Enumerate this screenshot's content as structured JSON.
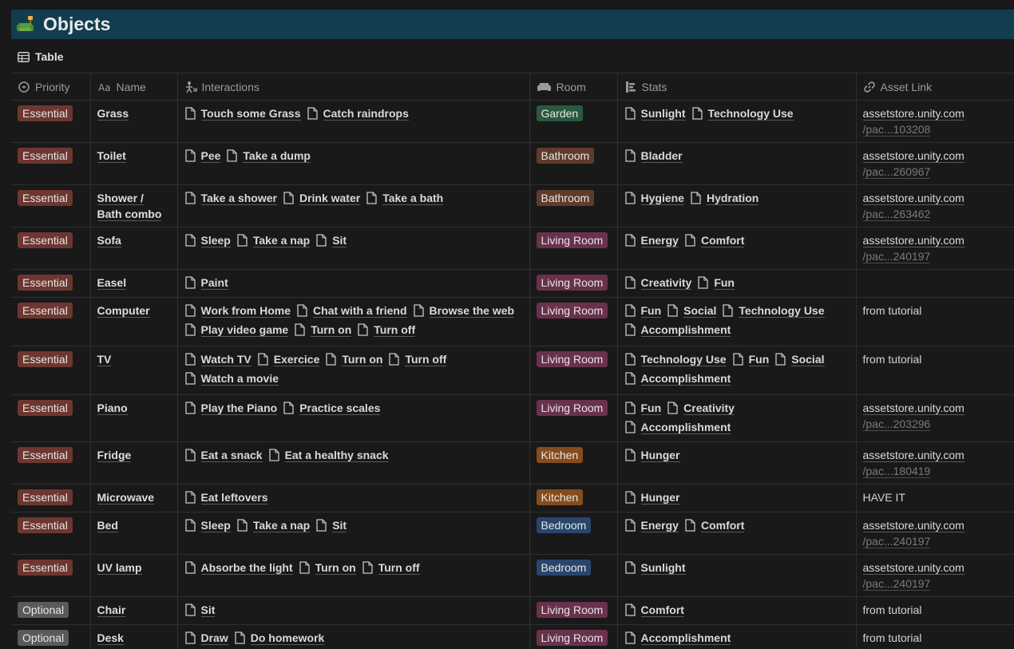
{
  "page": {
    "title": "Objects",
    "view_label": "Table"
  },
  "columns": [
    "Priority",
    "Name",
    "Interactions",
    "Room",
    "Stats",
    "Asset Link"
  ],
  "rows": [
    {
      "priority": "Essential",
      "name": "Grass",
      "interactions": [
        "Touch some Grass",
        "Catch raindrops"
      ],
      "room": "Garden",
      "room_key": "garden",
      "stats": [
        "Sunlight",
        "Technology Use"
      ],
      "asset_host": "assetstore.unity.com",
      "asset_path": "/pac...103208",
      "asset_text": ""
    },
    {
      "priority": "Essential",
      "name": "Toilet",
      "interactions": [
        "Pee",
        "Take a dump"
      ],
      "room": "Bathroom",
      "room_key": "bathroom",
      "stats": [
        "Bladder"
      ],
      "asset_host": "assetstore.unity.com",
      "asset_path": "/pac...260967",
      "asset_text": ""
    },
    {
      "priority": "Essential",
      "name": "Shower / Bath combo",
      "interactions": [
        "Take a shower",
        "Drink water",
        "Take a bath"
      ],
      "room": "Bathroom",
      "room_key": "bathroom",
      "stats": [
        "Hygiene",
        "Hydration"
      ],
      "asset_host": "assetstore.unity.com",
      "asset_path": "/pac...263462",
      "asset_text": ""
    },
    {
      "priority": "Essential",
      "name": "Sofa",
      "interactions": [
        "Sleep",
        "Take a nap",
        "Sit"
      ],
      "room": "Living Room",
      "room_key": "living",
      "stats": [
        "Energy",
        "Comfort"
      ],
      "asset_host": "assetstore.unity.com",
      "asset_path": "/pac...240197",
      "asset_text": ""
    },
    {
      "priority": "Essential",
      "name": "Easel",
      "interactions": [
        "Paint"
      ],
      "room": "Living Room",
      "room_key": "living",
      "stats": [
        "Creativity",
        "Fun"
      ],
      "asset_host": "",
      "asset_path": "",
      "asset_text": ""
    },
    {
      "priority": "Essential",
      "name": "Computer",
      "interactions": [
        "Work from Home",
        "Chat with a friend",
        "Browse the web",
        "Play video game",
        "Turn on",
        "Turn off"
      ],
      "room": "Living Room",
      "room_key": "living",
      "stats": [
        "Fun",
        "Social",
        "Technology Use",
        "Accomplishment"
      ],
      "asset_host": "",
      "asset_path": "",
      "asset_text": "from tutorial"
    },
    {
      "priority": "Essential",
      "name": "TV",
      "interactions": [
        "Watch TV",
        "Exercice",
        "Turn on",
        "Turn off",
        "Watch a movie"
      ],
      "room": "Living Room",
      "room_key": "living",
      "stats": [
        "Technology Use",
        "Fun",
        "Social",
        "Accomplishment"
      ],
      "asset_host": "",
      "asset_path": "",
      "asset_text": "from tutorial"
    },
    {
      "priority": "Essential",
      "name": "Piano",
      "interactions": [
        "Play the Piano",
        "Practice scales"
      ],
      "room": "Living Room",
      "room_key": "living",
      "stats": [
        "Fun",
        "Creativity",
        "Accomplishment"
      ],
      "asset_host": "assetstore.unity.com",
      "asset_path": "/pac...203296",
      "asset_text": ""
    },
    {
      "priority": "Essential",
      "name": "Fridge",
      "interactions": [
        "Eat a snack",
        "Eat a healthy snack"
      ],
      "room": "Kitchen",
      "room_key": "kitchen",
      "stats": [
        "Hunger"
      ],
      "asset_host": "assetstore.unity.com",
      "asset_path": "/pac...180419",
      "asset_text": ""
    },
    {
      "priority": "Essential",
      "name": "Microwave",
      "interactions": [
        "Eat leftovers"
      ],
      "room": "Kitchen",
      "room_key": "kitchen",
      "stats": [
        "Hunger"
      ],
      "asset_host": "",
      "asset_path": "",
      "asset_text": "HAVE IT"
    },
    {
      "priority": "Essential",
      "name": "Bed",
      "interactions": [
        "Sleep",
        "Take a nap",
        "Sit"
      ],
      "room": "Bedroom",
      "room_key": "bedroom",
      "stats": [
        "Energy",
        "Comfort"
      ],
      "asset_host": "assetstore.unity.com",
      "asset_path": "/pac...240197",
      "asset_text": ""
    },
    {
      "priority": "Essential",
      "name": "UV lamp",
      "interactions": [
        "Absorbe the light",
        "Turn on",
        "Turn off"
      ],
      "room": "Bedroom",
      "room_key": "bedroom",
      "stats": [
        "Sunlight"
      ],
      "asset_host": "assetstore.unity.com",
      "asset_path": "/pac...240197",
      "asset_text": ""
    },
    {
      "priority": "Optional",
      "name": "Chair",
      "interactions": [
        "Sit"
      ],
      "room": "Living Room",
      "room_key": "living",
      "stats": [
        "Comfort"
      ],
      "asset_host": "",
      "asset_path": "",
      "asset_text": "from tutorial"
    },
    {
      "priority": "Optional",
      "name": "Desk",
      "interactions": [
        "Draw",
        "Do homework"
      ],
      "room": "Living Room",
      "room_key": "living",
      "stats": [
        "Accomplishment"
      ],
      "asset_host": "",
      "asset_path": "",
      "asset_text": "from tutorial"
    }
  ],
  "colors": {
    "banner": "#113d4e",
    "essential": "#6e3630",
    "optional": "#5a5a5a",
    "garden": "#2b593f",
    "bathroom": "#603b2c",
    "living": "#69314c",
    "kitchen": "#854c1d",
    "bedroom": "#28456c"
  },
  "icons": {
    "title": "sofa-icon",
    "view": "table-icon",
    "priority": "status-icon",
    "name": "text-icon",
    "interactions": "relation-icon",
    "room": "couch-icon",
    "stats": "relation-icon",
    "asset": "link-icon",
    "item": "page-icon"
  }
}
